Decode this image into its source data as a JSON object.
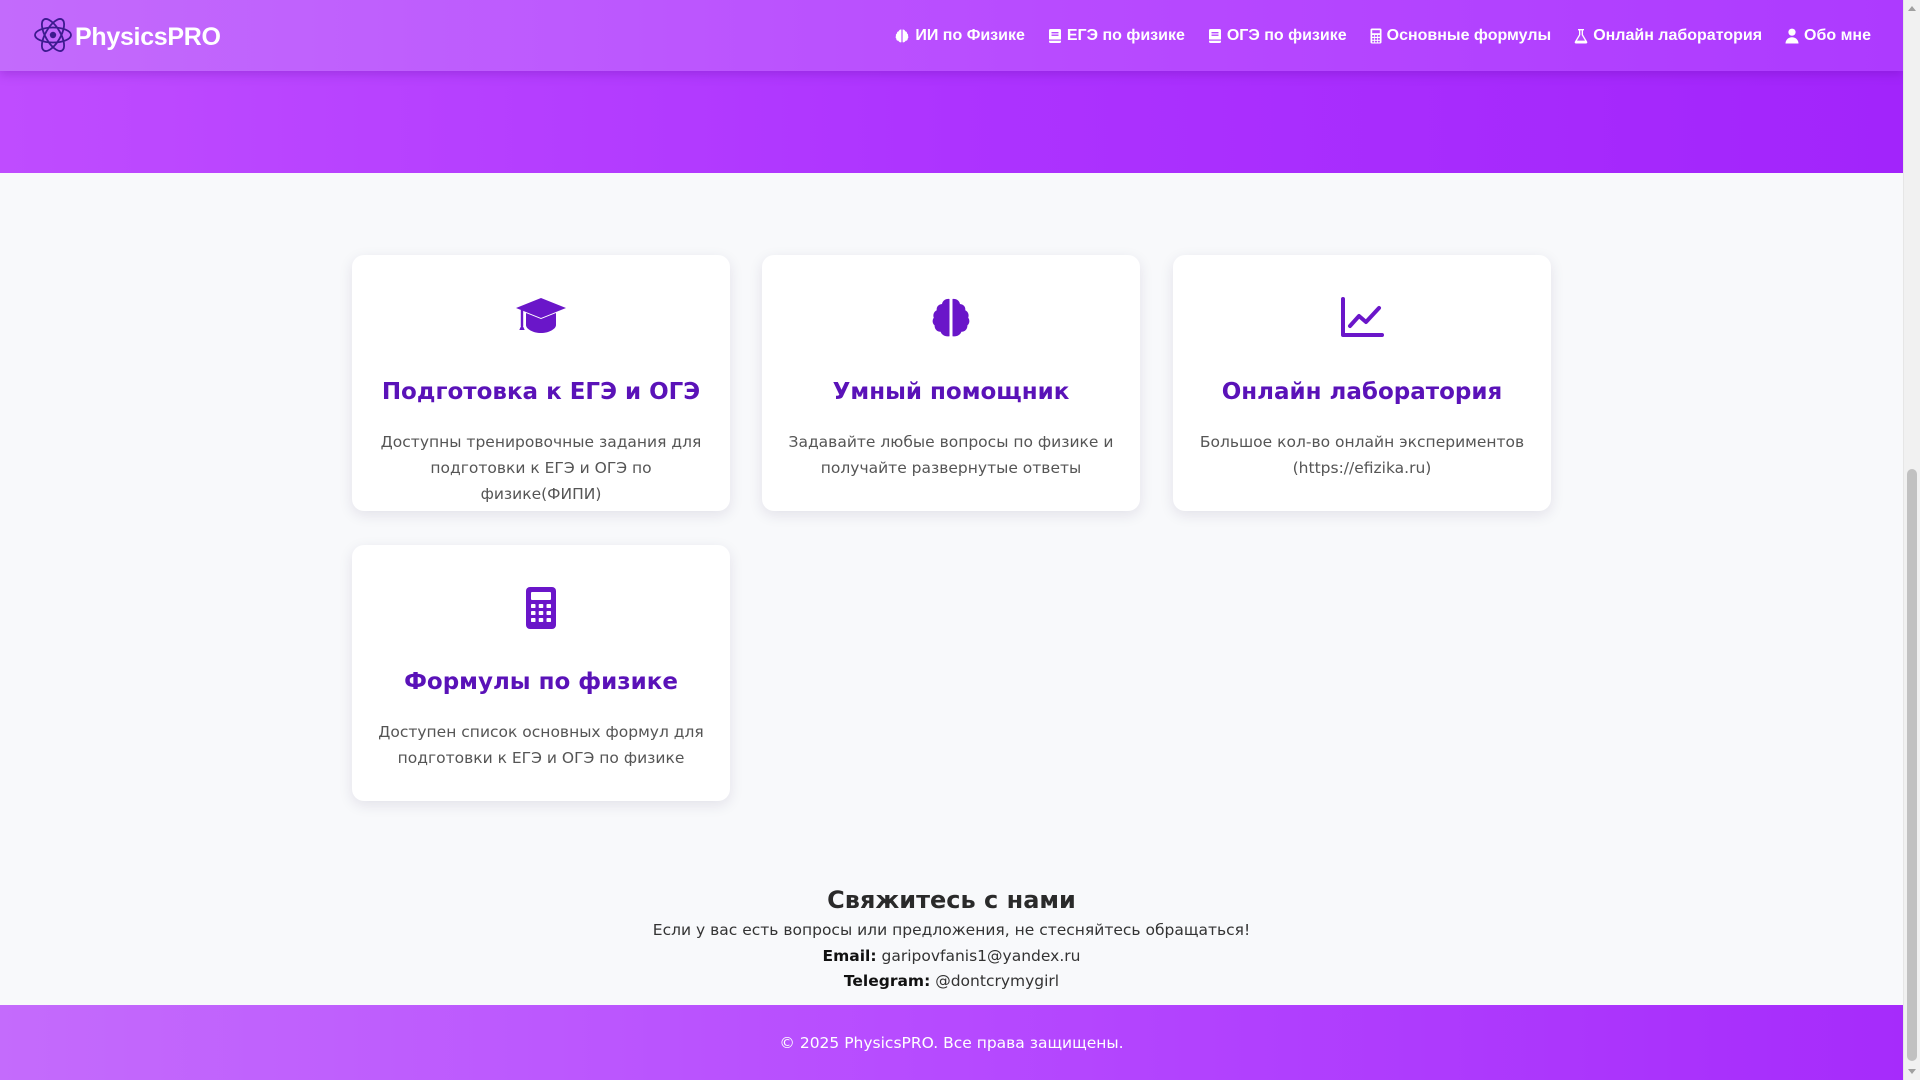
{
  "brand": {
    "name": "PhysicsPRO",
    "logo_icon": "atom-icon"
  },
  "nav": [
    {
      "label": "ИИ по Физике",
      "icon": "brain-icon"
    },
    {
      "label": "ЕГЭ по физике",
      "icon": "book-icon"
    },
    {
      "label": "ОГЭ по физике",
      "icon": "book-icon"
    },
    {
      "label": "Основные формулы",
      "icon": "calculator-icon"
    },
    {
      "label": "Онлайн лаборатория",
      "icon": "flask-icon"
    },
    {
      "label": "Обо мне",
      "icon": "user-icon"
    }
  ],
  "colors": {
    "accent": "#5a12b8",
    "brand": "#b84bff",
    "icon": "#6a16c9"
  },
  "features": [
    {
      "icon": "graduation-cap-icon",
      "title": "Подготовка к ЕГЭ и ОГЭ",
      "text": "Доступны тренировочные задания для подготовки к ЕГЭ и ОГЭ по физике(ФИПИ)"
    },
    {
      "icon": "brain-icon",
      "title": "Умный помощник",
      "text": "Задавайте любые вопросы по физике и получайте развернутые ответы"
    },
    {
      "icon": "chart-line-icon",
      "title": "Онлайн лаборатория",
      "text": "Большое кол-во онлайн экспериментов (https://efizika.ru)"
    },
    {
      "icon": "calculator-icon",
      "title": "Формулы по физике",
      "text": "Доступен список основных формул для подготовки к ЕГЭ и ОГЭ по физике"
    }
  ],
  "contact": {
    "title": "Свяжитесь с нами",
    "intro": "Если у вас есть вопросы или предложения, не стесняйтесь обращаться!",
    "email_label": "Email:",
    "email": "garipovfanis1@yandex.ru",
    "telegram_label": "Telegram:",
    "telegram": "@dontcrymygirl"
  },
  "footer": {
    "text": "© 2025 PhysicsPRO. Все права защищены."
  }
}
